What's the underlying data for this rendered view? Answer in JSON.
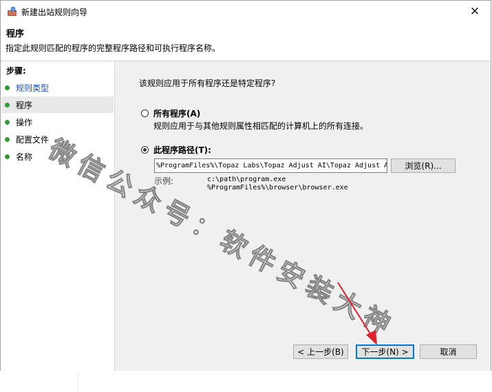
{
  "window": {
    "title": "新建出站规则向导",
    "close_glyph": "✕"
  },
  "header": {
    "title": "程序",
    "description": "指定此规则匹配的程序的完整程序路径和可执行程序名称。"
  },
  "sidebar": {
    "steps_label": "步骤:",
    "items": [
      {
        "label": "规则类型",
        "state": "link"
      },
      {
        "label": "程序",
        "state": "current"
      },
      {
        "label": "操作",
        "state": "normal"
      },
      {
        "label": "配置文件",
        "state": "normal"
      },
      {
        "label": "名称",
        "state": "normal"
      }
    ]
  },
  "main": {
    "question": "该规则应用于所有程序还是特定程序?",
    "all_programs": {
      "label": "所有程序(A)",
      "description": "规则应用于与其他规则属性相匹配的计算机上的所有连接。",
      "checked": false
    },
    "this_program": {
      "label": "此程序路径(T):",
      "checked": true
    },
    "path_value": "%ProgramFiles%\\Topaz Labs\\Topaz Adjust AI\\Topaz Adjust AI",
    "browse_label": "浏览(R)...",
    "example_label": "示例:",
    "example_lines": [
      "c:\\path\\program.exe",
      "%ProgramFiles%\\browser\\browser.exe"
    ]
  },
  "footer": {
    "back_label": "< 上一步(B)",
    "next_label": "下一步(N) >",
    "cancel_label": "取消"
  },
  "watermark": "微信公众号：软件安装大神",
  "colors": {
    "step_dot": "#2e9c2e",
    "link_text": "#1a4fb5",
    "annotation_arrow": "#e0202a",
    "focus_border": "#0078d7"
  }
}
